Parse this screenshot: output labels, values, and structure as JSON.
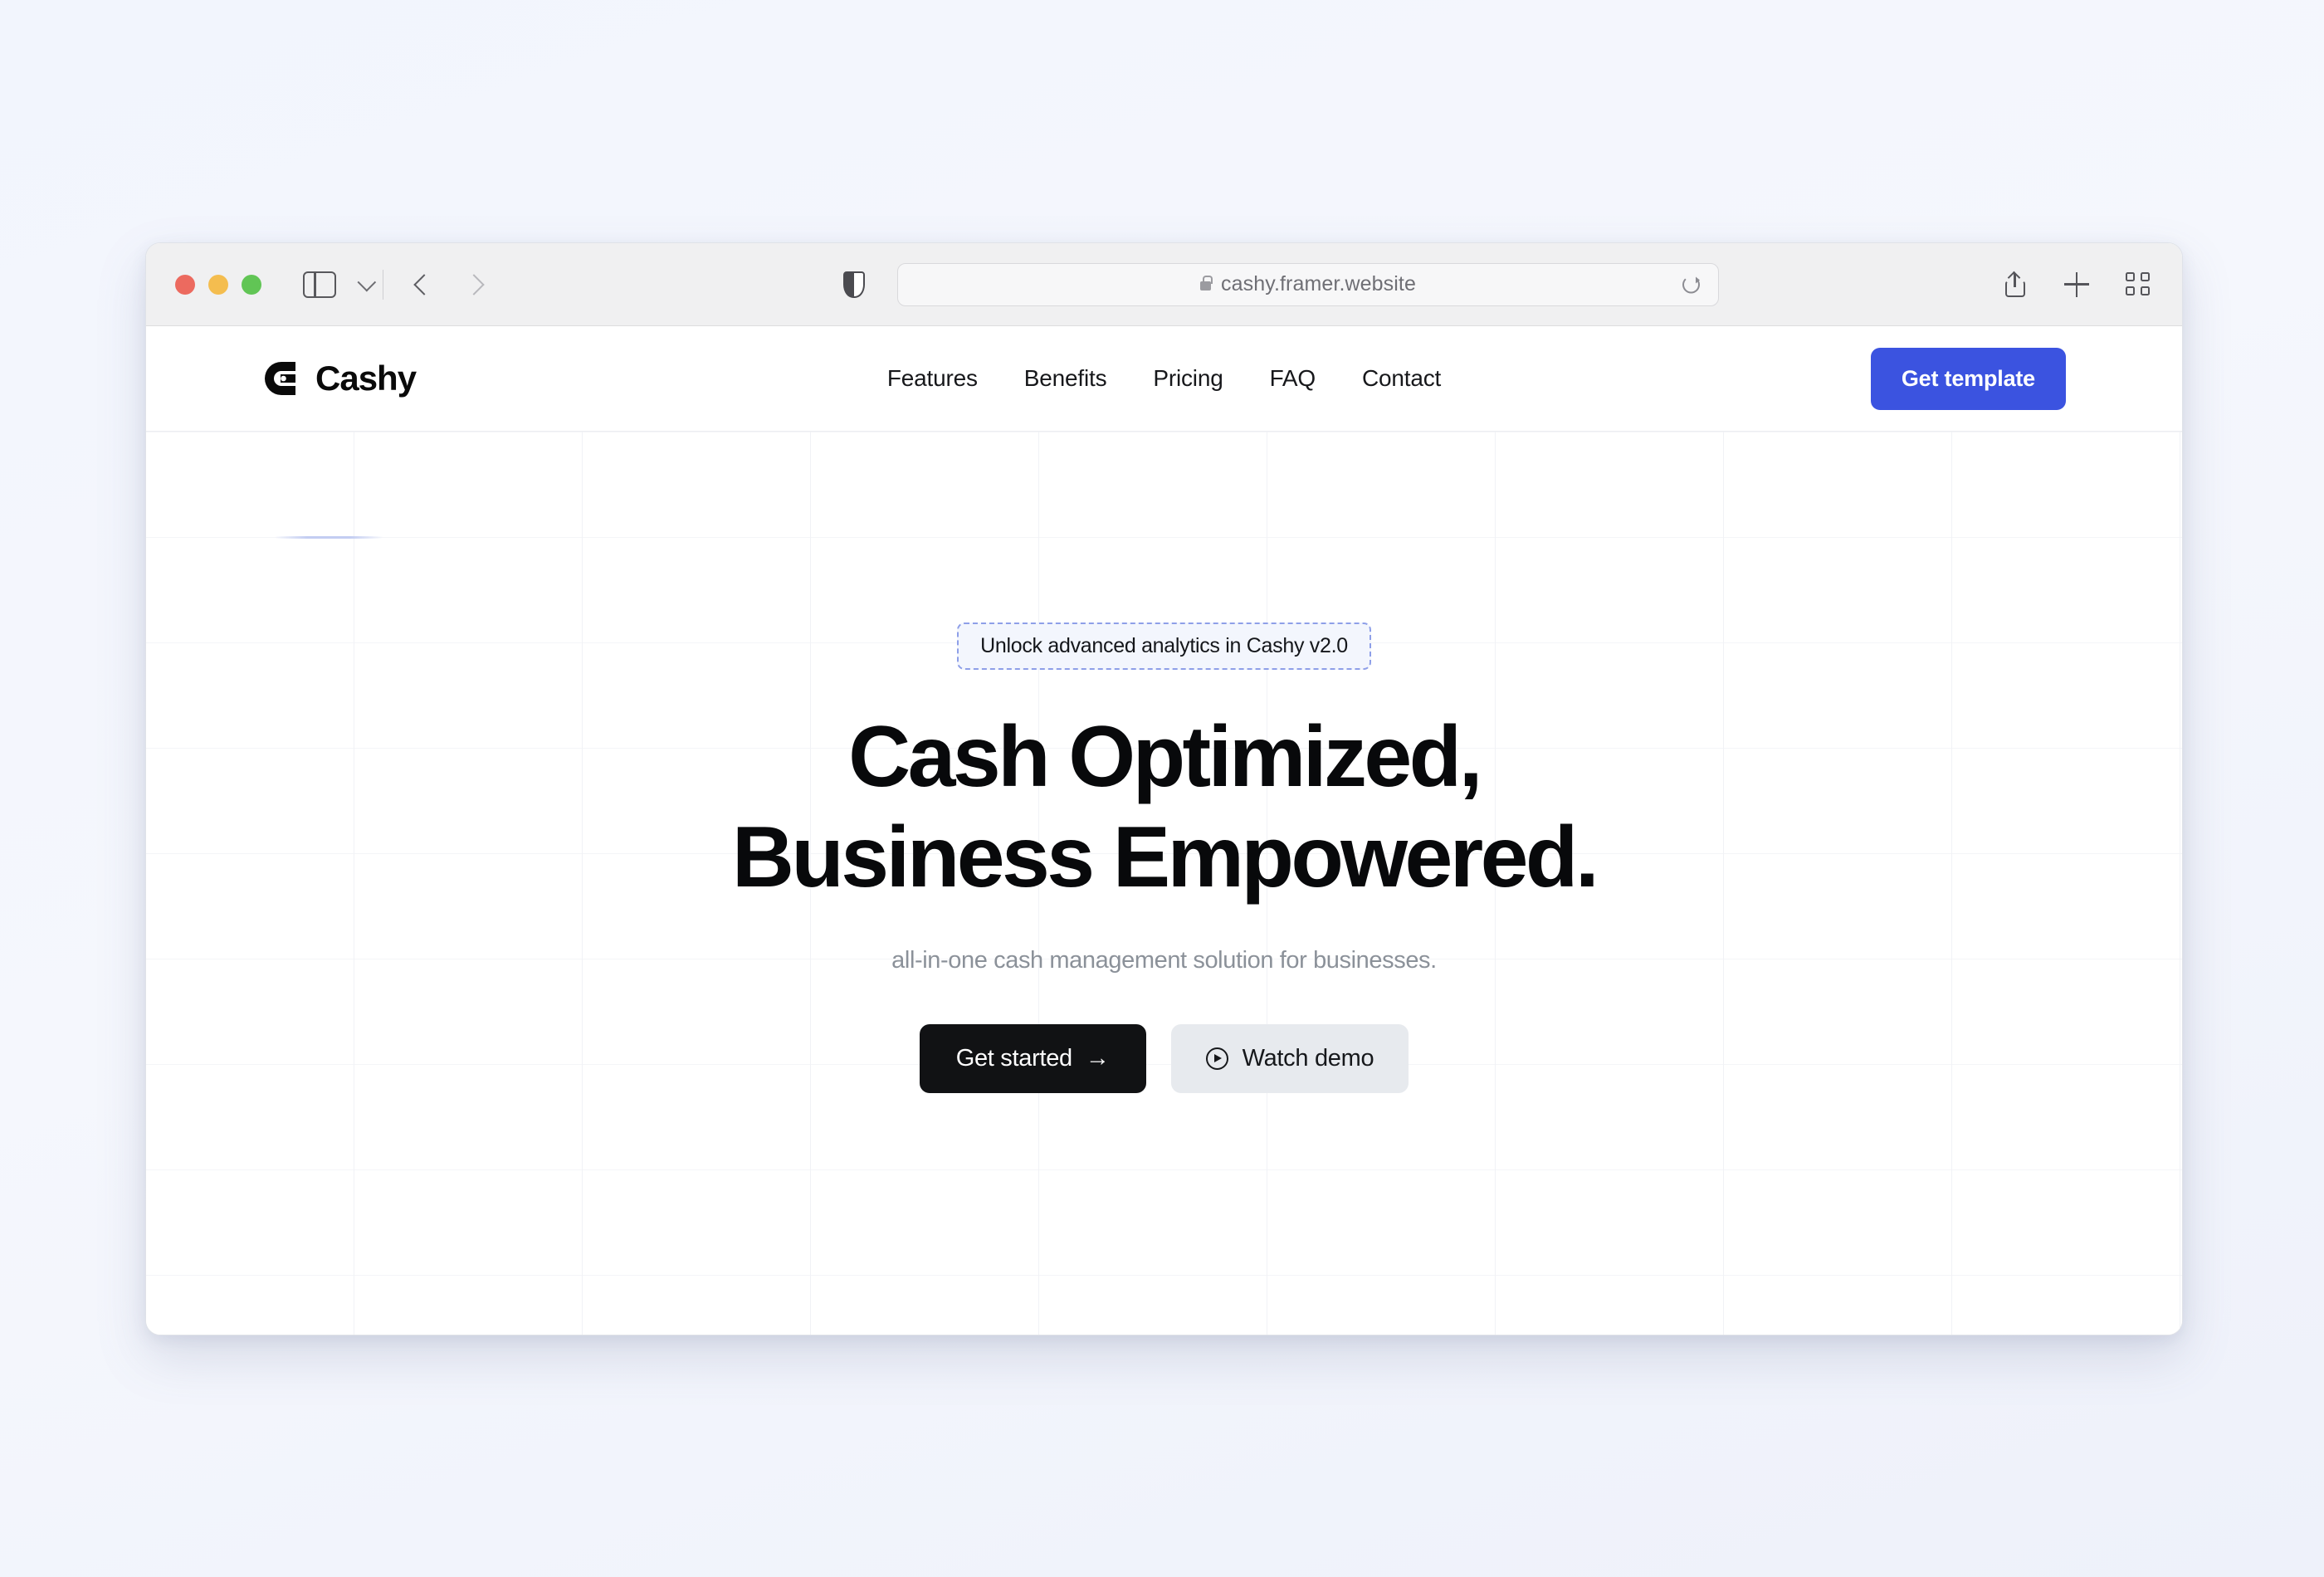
{
  "browser": {
    "url": "cashy.framer.website",
    "lock_icon": "lock-icon",
    "reload_icon": "reload-icon",
    "share_icon": "share-icon",
    "new_tab_icon": "plus-icon",
    "tab_overview_icon": "grid-icon",
    "sidebar_icon": "sidebar-toggle-icon",
    "back_icon": "chevron-left-icon",
    "forward_icon": "chevron-right-icon",
    "privacy_icon": "shield-icon"
  },
  "site": {
    "brand": {
      "name": "Cashy",
      "logo_icon": "cashy-logo-icon"
    },
    "nav": [
      {
        "label": "Features"
      },
      {
        "label": "Benefits"
      },
      {
        "label": "Pricing"
      },
      {
        "label": "FAQ"
      },
      {
        "label": "Contact"
      }
    ],
    "header_cta": {
      "label": "Get template"
    },
    "hero": {
      "badge": "Unlock advanced analytics in Cashy v2.0",
      "headline_line1": "Cash Optimized,",
      "headline_line2": "Business Empowered.",
      "subtitle": "all-in-one cash management solution for businesses.",
      "primary_cta": "Get started",
      "primary_cta_arrow": "→",
      "secondary_cta": "Watch demo",
      "secondary_cta_icon": "play-circle-icon"
    }
  },
  "colors": {
    "accent_blue": "#3b53e0",
    "badge_border": "#8e9fe8",
    "badge_fill": "#f3f6fd",
    "primary_button": "#111214",
    "secondary_button": "#e7eaee",
    "page_background": "#f3f6fd",
    "text_dark": "#08090b",
    "text_muted": "#8b9199"
  }
}
